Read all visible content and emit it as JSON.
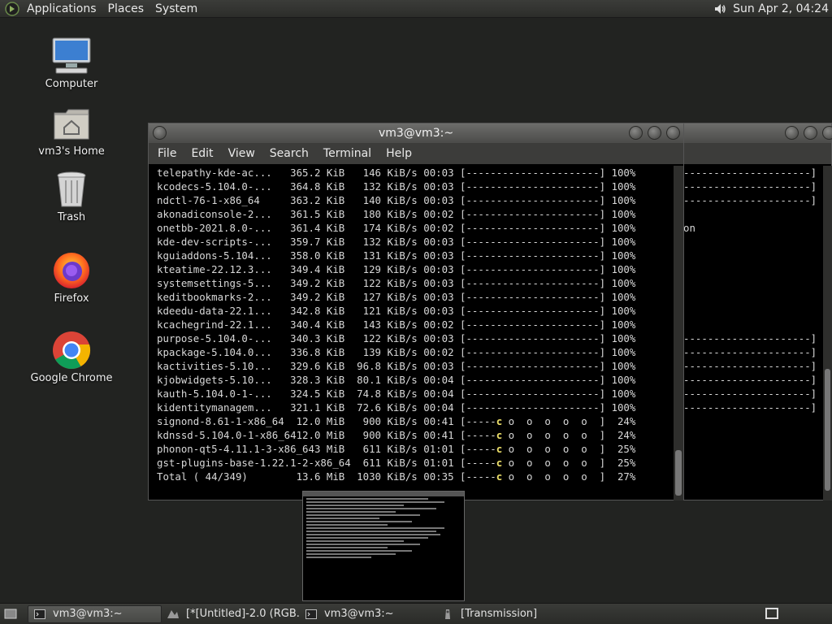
{
  "top_panel": {
    "menus": [
      "Applications",
      "Places",
      "System"
    ],
    "clock": "Sun Apr  2, 04:24",
    "volume_icon": "volume-icon"
  },
  "desktop": {
    "icons": [
      {
        "label": "Computer",
        "icon": "computer-icon"
      },
      {
        "label": "vm3's Home",
        "icon": "home-folder-icon"
      },
      {
        "label": "Trash",
        "icon": "trash-icon"
      },
      {
        "label": "Firefox",
        "icon": "firefox-icon"
      },
      {
        "label": "Google Chrome",
        "icon": "chrome-icon"
      }
    ]
  },
  "terminal": {
    "title": "vm3@vm3:~",
    "menu": [
      "File",
      "Edit",
      "View",
      "Search",
      "Terminal",
      "Help"
    ],
    "lines": [
      "telepathy-kde-ac...   365.2 KiB   146 KiB/s 00:03 [----------------------] 100%",
      "kcodecs-5.104.0-...   364.8 KiB   132 KiB/s 00:03 [----------------------] 100%",
      "ndctl-76-1-x86_64     363.2 KiB   140 KiB/s 00:03 [----------------------] 100%",
      "akonadiconsole-2...   361.5 KiB   180 KiB/s 00:02 [----------------------] 100%",
      "onetbb-2021.8.0-...   361.4 KiB   174 KiB/s 00:02 [----------------------] 100%",
      "kde-dev-scripts-...   359.7 KiB   132 KiB/s 00:03 [----------------------] 100%",
      "kguiaddons-5.104...   358.0 KiB   131 KiB/s 00:03 [----------------------] 100%",
      "kteatime-22.12.3...   349.4 KiB   129 KiB/s 00:03 [----------------------] 100%",
      "systemsettings-5...   349.2 KiB   122 KiB/s 00:03 [----------------------] 100%",
      "keditbookmarks-2...   349.2 KiB   127 KiB/s 00:03 [----------------------] 100%",
      "kdeedu-data-22.1...   342.8 KiB   121 KiB/s 00:03 [----------------------] 100%",
      "kcachegrind-22.1...   340.4 KiB   143 KiB/s 00:02 [----------------------] 100%",
      "purpose-5.104.0-...   340.3 KiB   122 KiB/s 00:03 [----------------------] 100%",
      "kpackage-5.104.0...   336.8 KiB   139 KiB/s 00:02 [----------------------] 100%",
      "kactivities-5.10...   329.6 KiB  96.8 KiB/s 00:03 [----------------------] 100%",
      "kjobwidgets-5.10...   328.3 KiB  80.1 KiB/s 00:04 [----------------------] 100%",
      "kauth-5.104.0-1-...   324.5 KiB  74.8 KiB/s 00:04 [----------------------] 100%",
      "kidentitymanagem...   321.1 KiB  72.6 KiB/s 00:04 [----------------------] 100%",
      "signond-8.61-1-x86_64  12.0 MiB   900 KiB/s 00:41 [-----c o  o  o  o  o  ]  24%",
      "kdnssd-5.104.0-1-x86_6412.0 MiB   900 KiB/s 00:41 [-----c o  o  o  o  o  ]  24%",
      "phonon-qt5-4.11.1-3-x86_643 MiB   611 KiB/s 01:01 [-----c o  o  o  o  o  ]  25%",
      "gst-plugins-base-1.22.1-2-x86_64  611 KiB/s 01:01 [-----c o  o  o  o  o  ]  25%",
      "Total ( 44/349)        13.6 MiB  1030 KiB/s 00:35 [-----c o  o  o  o  o  ]  27%"
    ]
  },
  "bg_terminal": {
    "lines": [
      "---------------------] 100%",
      "---------------------] 100%",
      "---------------------] 100%",
      "",
      "on",
      "",
      "",
      "",
      "",
      "",
      "",
      "",
      "---------------------] 100%",
      "---------------------] 100%",
      "---------------------] 100%",
      "---------------------] 100%",
      "---------------------] 100%",
      "---------------------] 100%"
    ]
  },
  "taskbar": {
    "tasks": [
      {
        "label": "vm3@vm3:~",
        "icon": "terminal-icon",
        "active": true
      },
      {
        "label": "[*[Untitled]-2.0 (RGB...",
        "icon": "gimp-icon",
        "active": false
      },
      {
        "label": "vm3@vm3:~",
        "icon": "terminal-icon",
        "active": false
      },
      {
        "label": "[Transmission]",
        "icon": "transmission-icon",
        "active": false
      }
    ]
  }
}
